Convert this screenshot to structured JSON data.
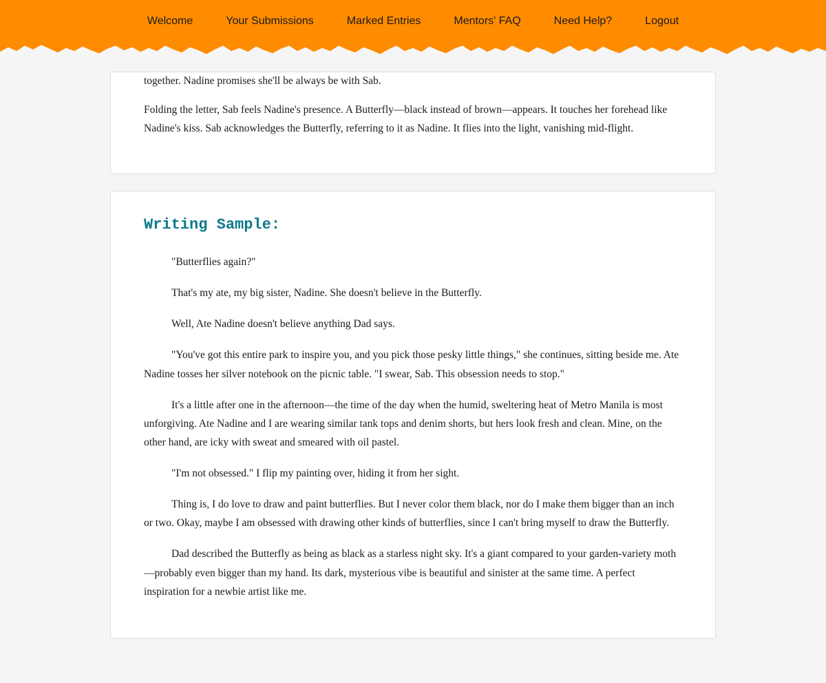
{
  "nav": {
    "items": [
      {
        "label": "Welcome",
        "href": "#"
      },
      {
        "label": "Your Submissions",
        "href": "#"
      },
      {
        "label": "Marked Entries",
        "href": "#"
      },
      {
        "label": "Mentors' FAQ",
        "href": "#"
      },
      {
        "label": "Need Help?",
        "href": "#"
      },
      {
        "label": "Logout",
        "href": "#"
      }
    ]
  },
  "page": {
    "partial_card": {
      "paragraphs": [
        "together. Nadine promises she'll be always be with Sab.",
        "Folding the letter, Sab feels Nadine's presence. A Butterfly—black instead of brown—appears. It touches her forehead like Nadine's kiss. Sab acknowledges the Butterfly, referring to it as Nadine. It flies into the light, vanishing mid-flight."
      ]
    },
    "writing_sample": {
      "heading": "Writing Sample:",
      "paragraphs": [
        {
          "text": "\"Butterflies again?\"",
          "indented": true
        },
        {
          "text": "That's my ate, my big sister, Nadine. She doesn't believe in the Butterfly.",
          "indented": true
        },
        {
          "text": "Well, Ate Nadine doesn't believe anything Dad says.",
          "indented": true
        },
        {
          "text": "\"You've got this entire park to inspire you, and you pick those pesky little things,\" she continues, sitting beside me. Ate Nadine tosses her silver notebook on the picnic table. \"I swear, Sab. This obsession needs to stop.\"",
          "indented": true
        },
        {
          "text": "It's a little after one in the afternoon—the time of the day when the humid, sweltering heat of Metro Manila is most unforgiving. Ate Nadine and I are wearing similar tank tops and denim shorts, but hers look fresh and clean. Mine, on the other hand, are icky with sweat and smeared with oil pastel.",
          "indented": true
        },
        {
          "text": "\"I'm not obsessed.\" I flip my painting over, hiding it from her sight.",
          "indented": true
        },
        {
          "text": "Thing is, I do love to draw and paint butterflies. But I never color them black, nor do I make them bigger than an inch or two. Okay, maybe I am obsessed with drawing other kinds of butterflies, since I can't bring myself to draw the Butterfly.",
          "indented": true
        },
        {
          "text": "Dad described the Butterfly as being as black as a starless night sky. It's a giant compared to your garden-variety moth—probably even bigger than my hand. Its dark, mysterious vibe is beautiful and sinister at the same time. A perfect inspiration for a newbie artist like me.",
          "indented": true
        }
      ]
    }
  }
}
